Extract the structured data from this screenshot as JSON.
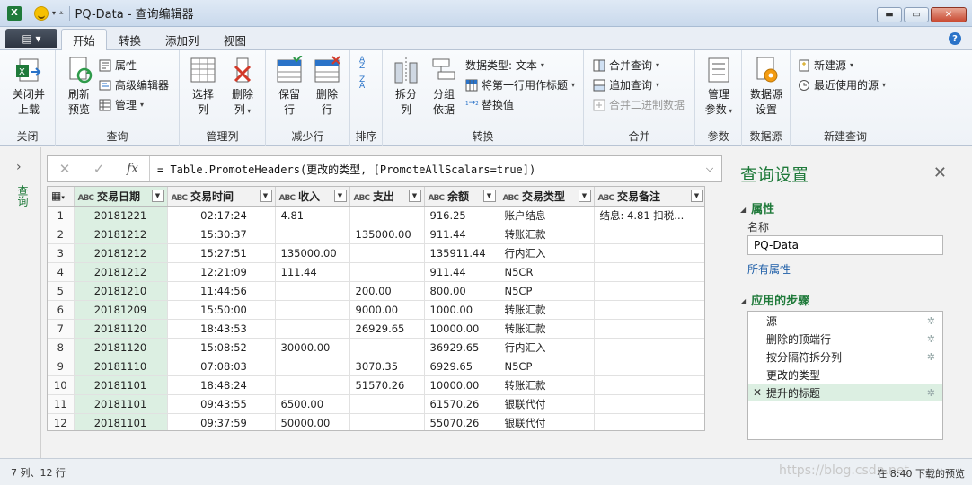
{
  "window": {
    "title": "PQ-Data - 查询编辑器",
    "app_icon": "X"
  },
  "tabs": {
    "file": "▤ ▾",
    "items": [
      "开始",
      "转换",
      "添加列",
      "视图"
    ]
  },
  "ribbon": {
    "close": {
      "btn": "关闭并\n上载",
      "label": "关闭"
    },
    "query": {
      "refresh": "刷新\n预览",
      "properties": "属性",
      "advanced": "高级编辑器",
      "manage": "管理",
      "label": "查询"
    },
    "manage_cols": {
      "select": "选择\n列",
      "remove": "删除\n列",
      "label": "管理列"
    },
    "reduce_rows": {
      "keep": "保留\n行",
      "remove": "删除\n行",
      "label": "减少行"
    },
    "sort": {
      "label": "排序"
    },
    "transform": {
      "split": "拆分\n列",
      "group": "分组\n依据",
      "datatype": "数据类型: 文本",
      "first_row": "将第一行用作标题",
      "replace": "替换值",
      "label": "转换"
    },
    "combine": {
      "merge": "合并查询",
      "append": "追加查询",
      "binary": "合并二进制数据",
      "label": "合并"
    },
    "params": {
      "manage": "管理\n参数",
      "label": "参数"
    },
    "datasource": {
      "settings": "数据源\n设置",
      "label": "数据源"
    },
    "new_query": {
      "new_source": "新建源",
      "recent": "最近使用的源",
      "label": "新建查询"
    }
  },
  "nav": {
    "label": "查询"
  },
  "formula": {
    "cancel": "✕",
    "confirm": "✓",
    "fx": "fx",
    "text": "= Table.PromoteHeaders(更改的类型, [PromoteAllScalars=true])"
  },
  "table": {
    "columns": [
      "交易日期",
      "交易时间",
      "收入",
      "支出",
      "余额",
      "交易类型",
      "交易备注"
    ],
    "rows": [
      [
        "1",
        "20181221",
        "02:17:24",
        "4.81",
        "",
        "916.25",
        "账户结息",
        "结息: 4.81 扣税..."
      ],
      [
        "2",
        "20181212",
        "15:30:37",
        "",
        "135000.00",
        "911.44",
        "转账汇款",
        ""
      ],
      [
        "3",
        "20181212",
        "15:27:51",
        "135000.00",
        "",
        "135911.44",
        "行内汇入",
        ""
      ],
      [
        "4",
        "20181212",
        "12:21:09",
        "111.44",
        "",
        "911.44",
        "N5CR",
        ""
      ],
      [
        "5",
        "20181210",
        "11:44:56",
        "",
        "200.00",
        "800.00",
        "N5CP",
        ""
      ],
      [
        "6",
        "20181209",
        "15:50:00",
        "",
        "9000.00",
        "1000.00",
        "转账汇款",
        ""
      ],
      [
        "7",
        "20181120",
        "18:43:53",
        "",
        "26929.65",
        "10000.00",
        "转账汇款",
        ""
      ],
      [
        "8",
        "20181120",
        "15:08:52",
        "30000.00",
        "",
        "36929.65",
        "行内汇入",
        ""
      ],
      [
        "9",
        "20181110",
        "07:08:03",
        "",
        "3070.35",
        "6929.65",
        "N5CP",
        ""
      ],
      [
        "10",
        "20181101",
        "18:48:24",
        "",
        "51570.26",
        "10000.00",
        "转账汇款",
        ""
      ],
      [
        "11",
        "20181101",
        "09:43:55",
        "6500.00",
        "",
        "61570.26",
        "银联代付",
        ""
      ],
      [
        "12",
        "20181101",
        "09:37:59",
        "50000.00",
        "",
        "55070.26",
        "银联代付",
        ""
      ]
    ]
  },
  "settings": {
    "title": "查询设置",
    "properties_heading": "属性",
    "name_label": "名称",
    "name_value": "PQ-Data",
    "all_properties": "所有属性",
    "steps_heading": "应用的步骤",
    "steps": [
      "源",
      "删除的顶端行",
      "按分隔符拆分列",
      "更改的类型",
      "提升的标题"
    ],
    "selected_step": 4
  },
  "status": {
    "left": "7 列、12 行",
    "right": "在 8:40 下载的预览",
    "watermark": "https://blog.csdn.net"
  },
  "colors": {
    "accent_green": "#1f7a3a",
    "selected_bg": "#dcefe2"
  }
}
